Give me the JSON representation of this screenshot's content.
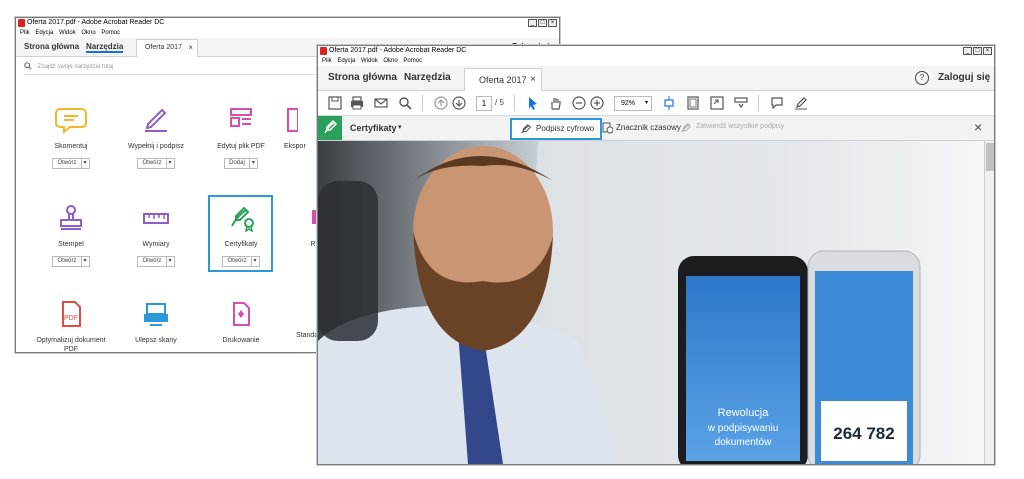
{
  "back_window": {
    "title": "Oferta 2017.pdf - Adobe Acrobat Reader DC",
    "menu": [
      "Plik",
      "Edycja",
      "Widok",
      "Okno",
      "Pomoc"
    ],
    "tabs": {
      "home": "Strona główna",
      "tools": "Narzędzia",
      "doc": "Oferta 2017",
      "close": "×"
    },
    "login_partial": "Zaloguj się",
    "search_placeholder": "Znajdź swoje narzędzia tutaj",
    "tools": [
      {
        "label": "Skomentuj",
        "button": "Otwórz",
        "icon": "comment-icon",
        "color": "#f3b62b"
      },
      {
        "label": "Wypełnij i podpisz",
        "button": "Otwórz",
        "icon": "fill-sign-icon",
        "color": "#8c5ec7"
      },
      {
        "label": "Edytuj plik PDF",
        "button": "Dodaj",
        "icon": "edit-pdf-icon",
        "color": "#d54fb0"
      },
      {
        "label": "Ekspor",
        "button": "",
        "icon": "export-icon",
        "color": "#d54fb0"
      },
      {
        "label": "Stempel",
        "button": "Otwórz",
        "icon": "stamp-icon",
        "color": "#8c5ec7"
      },
      {
        "label": "Wymiary",
        "button": "Otwórz",
        "icon": "ruler-icon",
        "color": "#8c5ec7"
      },
      {
        "label": "Certyfikaty",
        "button": "Otwórz",
        "icon": "certificate-icon",
        "color": "#2aa05a"
      },
      {
        "label": "R",
        "button": "",
        "icon": "redact-icon",
        "color": "#d54fb0"
      },
      {
        "label": "Optymalizuj dokument PDF",
        "button": "",
        "icon": "optimize-icon",
        "color": "#e04a3f"
      },
      {
        "label": "Ulepsz skany",
        "button": "",
        "icon": "scan-icon",
        "color": "#2c98d7"
      },
      {
        "label": "Drukowanie",
        "button": "",
        "icon": "print-production-icon",
        "color": "#d54fb0"
      },
      {
        "label": "Standa",
        "button": "",
        "icon": "standards-icon",
        "color": "#8c5ec7"
      }
    ]
  },
  "front_window": {
    "title": "Oferta 2017.pdf - Adobe Acrobat Reader DC",
    "menu": [
      "Plik",
      "Edycja",
      "Widok",
      "Okno",
      "Pomoc"
    ],
    "tabs": {
      "home": "Strona główna",
      "tools": "Narzędzia",
      "doc": "Oferta 2017",
      "close": "×"
    },
    "help": "?",
    "login": "Zaloguj się",
    "page_current": "1",
    "page_total": "/ 5",
    "zoom": "92%",
    "cert_bar": {
      "title": "Certyfikaty",
      "sign": "Podpisz cyfrowo",
      "timestamp": "Znacznik czasowy",
      "validate": "Zatwierdź wszystkie podpisy",
      "close": "×"
    },
    "phone_left": {
      "line1": "Rewolucja",
      "line2": "w podpisywaniu",
      "line3": "dokumentów"
    },
    "phone_right": {
      "number": "264 782"
    }
  },
  "colors": {
    "accent": "#1473e6",
    "highlight": "#2c98d7",
    "cert_green": "#2aa05a"
  }
}
